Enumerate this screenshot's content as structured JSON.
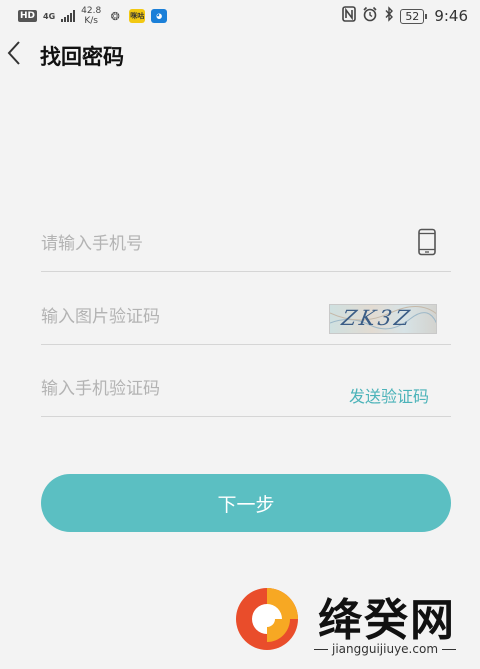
{
  "status_bar": {
    "hd": "HD",
    "network": "4G",
    "speed_value": "42.8",
    "speed_unit": "K/s",
    "app_yellow": "咪咕",
    "app_blue": "◕",
    "battery": "52",
    "time": "9:46"
  },
  "header": {
    "title": "找回密码"
  },
  "form": {
    "phone_placeholder": "请输入手机号",
    "captcha_placeholder": "输入图片验证码",
    "captcha_image_text": "ZK3Z",
    "sms_placeholder": "输入手机验证码",
    "send_code_label": "发送验证码",
    "next_label": "下一步"
  },
  "watermark": {
    "name": "绛癸网",
    "url": "jiangguijiuye.com"
  },
  "colors": {
    "accent": "#5bbfc2",
    "accent_text": "#4cb3b9",
    "background": "#f3f3f3"
  }
}
